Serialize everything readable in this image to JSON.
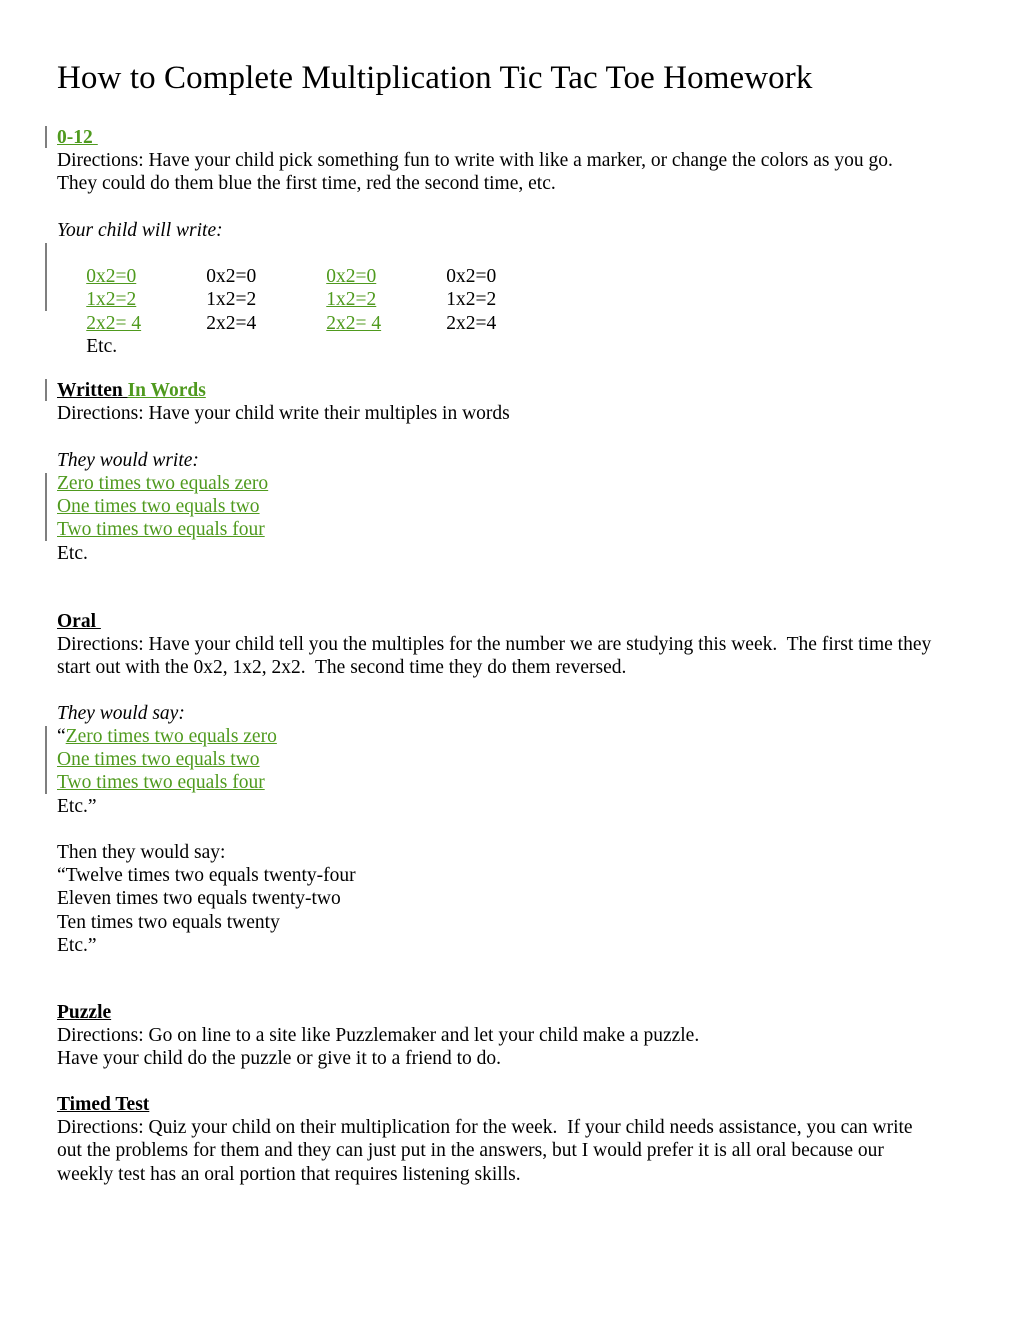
{
  "document": {
    "title": "How to Complete Multiplication Tic Tac Toe Homework",
    "colors": {
      "text": "#000000",
      "revision_green": "#4f9a1e",
      "change_bar_gray": "#7f7f7f",
      "page_background": "#ffffff"
    }
  },
  "sections": {
    "zero_twelve": {
      "heading": "0-12 ",
      "directions_line1": "Directions: Have your child pick something fun to write with like a marker, or change the colors as you go.",
      "directions_line2": "They could do them blue the first time, red the second time, etc.",
      "lead_in": "Your child will write:",
      "table": {
        "rows": [
          [
            "0x2=0",
            "0x2=0",
            "0x2=0",
            "0x2=0"
          ],
          [
            "1x2=2",
            "1x2=2",
            "1x2=2",
            "1x2=2"
          ],
          [
            "2x2= 4",
            "2x2=4",
            "2x2= 4",
            "2x2=4"
          ]
        ],
        "green_columns": [
          0,
          2
        ],
        "etc": "Etc."
      }
    },
    "written_in_words": {
      "heading_black": "Written ",
      "heading_green": "In Words",
      "directions": "Directions: Have your child write their multiples in words",
      "lead_in": "They would write:",
      "examples": [
        "Zero times two equals zero",
        "One times two equals two",
        "Two times two equals four"
      ],
      "etc": "Etc."
    },
    "oral": {
      "heading": "Oral ",
      "directions_line1": "Directions: Have your child tell you the multiples for the number we are studying this week.  The first time they",
      "directions_line2": "start out with the 0x2, 1x2, 2x2.  The second time they do them reversed.",
      "lead_in": "They would say:",
      "open_quote": "“",
      "examples": [
        "Zero times two equals zero",
        "One times two equals two",
        "Two times two equals four"
      ],
      "etc_quoted": "Etc.”",
      "then_lead_in": "Then they would say:",
      "reversed": [
        "“Twelve times two equals twenty-four",
        "Eleven times two equals twenty-two",
        "Ten times two equals twenty",
        "Etc.”"
      ]
    },
    "puzzle": {
      "heading": "Puzzle",
      "directions_line1": "Directions: Go on line to a site like Puzzlemaker and let your child make a puzzle.",
      "directions_line2": "Have your child do the puzzle or give it to a friend to do."
    },
    "timed_test": {
      "heading": "Timed Test",
      "directions_line1": "Directions: Quiz your child on their multiplication for the week.  If your child needs assistance, you can write",
      "directions_line2": "out the problems for them and they can just put in the answers, but I would prefer it is all oral because our",
      "directions_line3": "weekly test has an oral portion that requires listening skills."
    }
  }
}
